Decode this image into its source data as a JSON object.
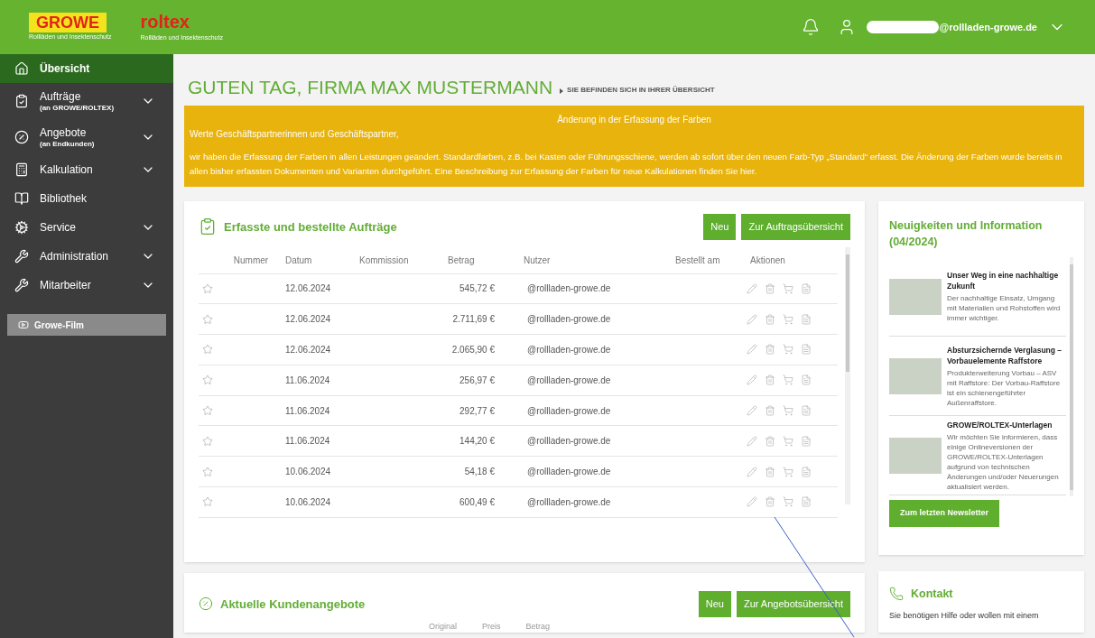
{
  "header": {
    "logos": [
      {
        "name": "GROWE",
        "tagline": "Rollläden und Insektenschutz"
      },
      {
        "name": "roltex",
        "tagline": "Rollläden und Insektenschutz"
      }
    ],
    "user_email": "@rollladen-growe.de"
  },
  "sidebar": {
    "items": [
      {
        "label": "Übersicht",
        "selected": true,
        "has_submenu": false
      },
      {
        "label": "Aufträge",
        "sublabel": "(an GROWE/ROLTEX)",
        "selected": false,
        "has_submenu": true
      },
      {
        "label": "Angebote",
        "sublabel": "(an Endkunden)",
        "selected": false,
        "has_submenu": true
      },
      {
        "label": "Kalkulation",
        "selected": false,
        "has_submenu": true
      },
      {
        "label": "Bibliothek",
        "selected": false,
        "has_submenu": false
      },
      {
        "label": "Service",
        "selected": false,
        "has_submenu": true
      },
      {
        "label": "Administration",
        "selected": false,
        "has_submenu": true
      },
      {
        "label": "Mitarbeiter",
        "selected": false,
        "has_submenu": true
      }
    ],
    "film_button": "Growe-Film"
  },
  "page_title": "GUTEN TAG, FIRMA MAX MUSTERMANN",
  "breadcrumb": "SIE BEFINDEN SICH IN IHRER ÜBERSICHT",
  "notice": {
    "title": "Änderung in der Erfassung der Farben",
    "greeting": "Werte Geschäftspartnerinnen und Geschäftspartner,",
    "body": "wir haben die Erfassung der Farben in allen Leistungen geändert. Standardfarben, z.B. bei Kasten oder Führungsschiene, werden ab sofort über den neuen Farb-Typ „Standard\" erfasst. Die Änderung der Farben wurde bereits in allen bisher erfassten Dokumenten und Varianten durchgeführt. Eine Beschreibung zur Erfassung der Farben für neue Kalkulationen finden Sie hier."
  },
  "orders": {
    "title": "Erfasste und bestellte Aufträge",
    "buttons": [
      "Neu",
      "Zur Auftragsübersicht"
    ],
    "columns": [
      "Nummer",
      "Datum",
      "Kommission",
      "Betrag",
      "Nutzer",
      "Bestellt am",
      "Aktionen"
    ],
    "rows": [
      {
        "starred": false,
        "datum": "12.06.2024",
        "betrag": "545,72 €",
        "nutzer": "@rollladen-growe.de"
      },
      {
        "starred": false,
        "datum": "12.06.2024",
        "betrag": "2.711,69 €",
        "nutzer": "@rollladen-growe.de"
      },
      {
        "starred": false,
        "datum": "12.06.2024",
        "betrag": "2.065,90 €",
        "nutzer": "@rollladen-growe.de"
      },
      {
        "starred": false,
        "datum": "11.06.2024",
        "betrag": "256,97 €",
        "nutzer": "@rollladen-growe.de"
      },
      {
        "starred": false,
        "datum": "11.06.2024",
        "betrag": "292,77 €",
        "nutzer": "@rollladen-growe.de"
      },
      {
        "starred": false,
        "datum": "11.06.2024",
        "betrag": "144,20 €",
        "nutzer": "@rollladen-growe.de"
      },
      {
        "starred": false,
        "datum": "10.06.2024",
        "betrag": "54,18 €",
        "nutzer": "@rollladen-growe.de"
      },
      {
        "starred": false,
        "datum": "10.06.2024",
        "betrag": "600,49 €",
        "nutzer": "@rollladen-growe.de"
      }
    ]
  },
  "offers": {
    "title": "Aktuelle Kundenangebote",
    "buttons": [
      "Neu",
      "Zur Angebotsübersicht"
    ],
    "columns": [
      "Original",
      "Preis",
      "Betrag"
    ]
  },
  "news": {
    "title": "Neuigkeiten und Information (04/2024)",
    "items": [
      {
        "title": "Unser Weg in eine nachhaltige Zukunft",
        "text": "Der nachhaltige Einsatz, Umgang mit Materialien und Rohstoffen wird immer wichtiger."
      },
      {
        "title": "Absturzsichernde Verglasung – Vorbauelemente Raffstore",
        "text": "Produkterweiterung Vorbau – ASV mit Raffstore: Der Vorbau-Raffstore ist ein schienengeführter Außenraffstore."
      },
      {
        "title": "GROWE/ROLTEX-Unterlagen",
        "text": "Wir möchten Sie informieren, dass einige Onlineversionen der GROWE/ROLTEX-Unterlagen aufgrund von technischen Änderungen und/oder Neuerungen aktualisiert werden."
      }
    ],
    "button": "Zum letzten Newsletter"
  },
  "contact": {
    "title": "Kontakt",
    "text": "Sie benötigen Hilfe oder wollen mit einem"
  }
}
